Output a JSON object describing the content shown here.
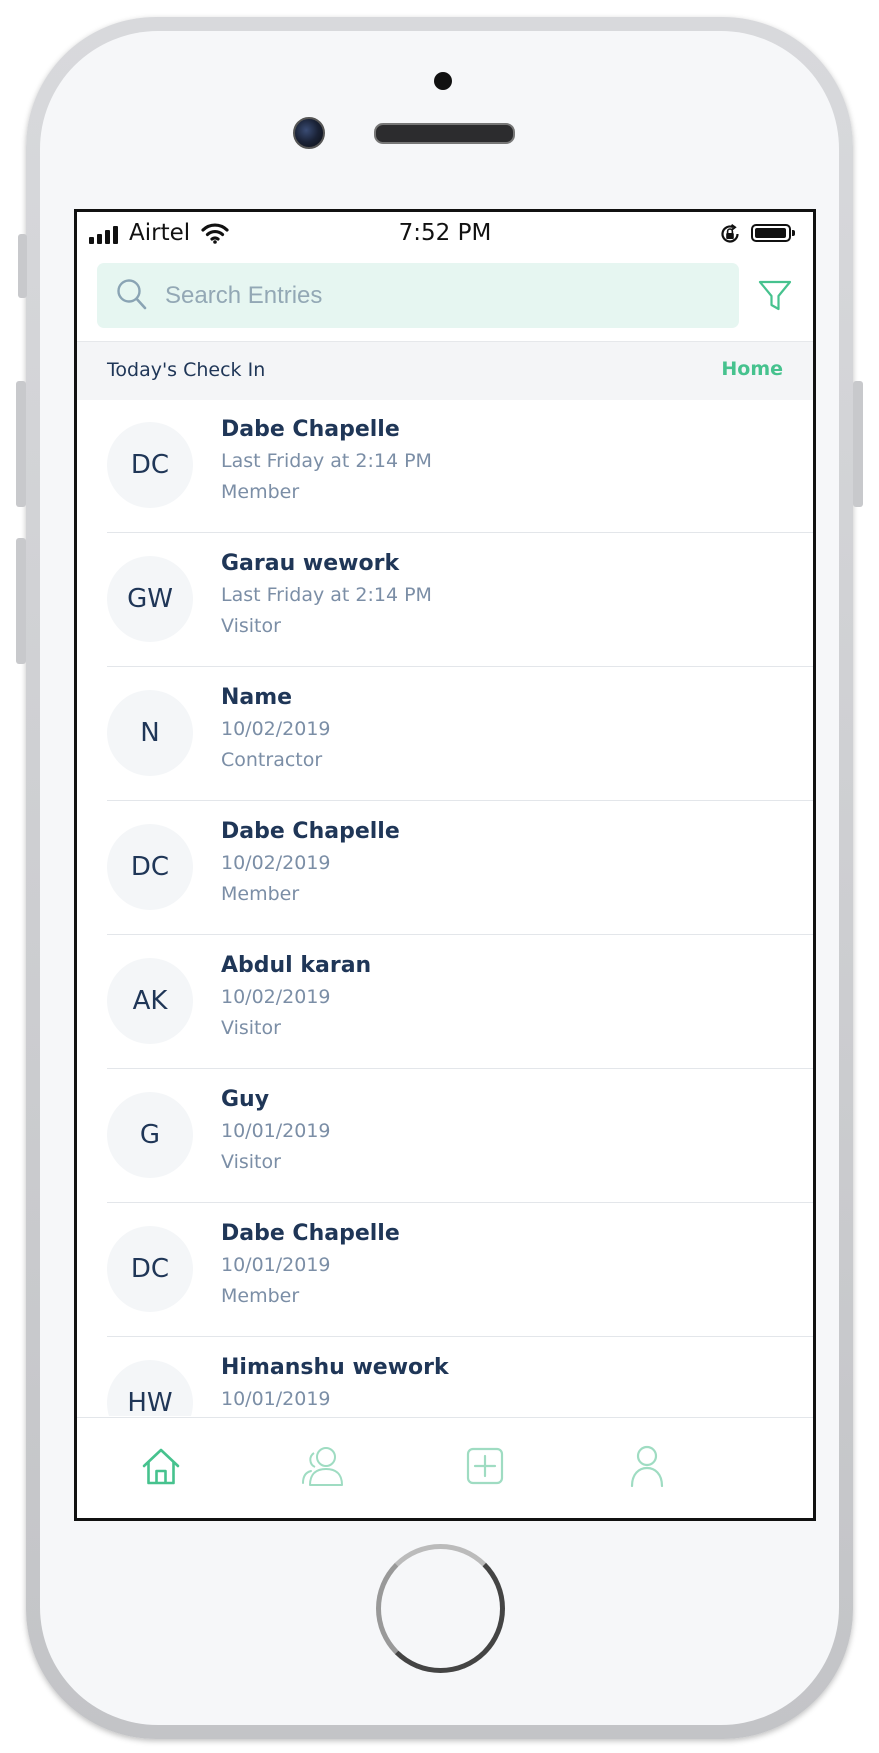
{
  "status_bar": {
    "carrier": "Airtel",
    "time": "7:52 PM"
  },
  "search": {
    "placeholder": "Search Entries",
    "value": ""
  },
  "section": {
    "title": "Today's Check In",
    "link": "Home"
  },
  "entries": [
    {
      "initials": "DC",
      "name": "Dabe Chapelle",
      "time": "Last Friday at 2:14 PM",
      "type": "Member"
    },
    {
      "initials": "GW",
      "name": "Garau wework",
      "time": "Last Friday at 2:14 PM",
      "type": "Visitor"
    },
    {
      "initials": "N",
      "name": "Name",
      "time": "10/02/2019",
      "type": "Contractor"
    },
    {
      "initials": "DC",
      "name": "Dabe Chapelle",
      "time": "10/02/2019",
      "type": "Member"
    },
    {
      "initials": "AK",
      "name": "Abdul karan",
      "time": "10/02/2019",
      "type": "Visitor"
    },
    {
      "initials": "G",
      "name": "Guy",
      "time": "10/01/2019",
      "type": "Visitor"
    },
    {
      "initials": "DC",
      "name": "Dabe Chapelle",
      "time": "10/01/2019",
      "type": "Member"
    },
    {
      "initials": "HW",
      "name": "Himanshu wework",
      "time": "10/01/2019",
      "type": ""
    }
  ],
  "tabs": [
    {
      "icon": "home-icon",
      "active": true
    },
    {
      "icon": "users-icon",
      "active": false
    },
    {
      "icon": "add-icon",
      "active": false
    },
    {
      "icon": "profile-icon",
      "active": false
    }
  ],
  "colors": {
    "accent": "#46c28e",
    "navy_text": "#1f3657",
    "muted_text": "#7b8ea6",
    "search_bg": "#e6f6f1"
  }
}
